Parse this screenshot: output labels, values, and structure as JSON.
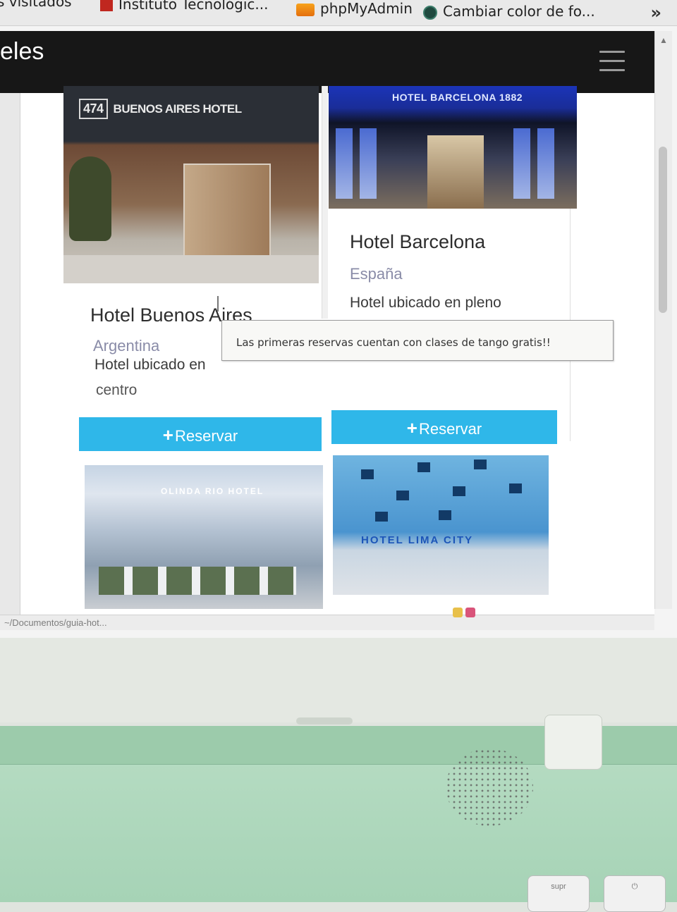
{
  "browser": {
    "bookmarks": [
      {
        "label": "s visitados",
        "icon": ""
      },
      {
        "label": "Instituto Tecnológic...",
        "icon": "institute-icon"
      },
      {
        "label": "phpMyAdmin",
        "icon": "phpmyadmin-icon"
      },
      {
        "label": "Cambiar color de fo...",
        "icon": "globe-icon"
      }
    ],
    "more": "»",
    "status_path": "~/Documentos/guia-hot..."
  },
  "navbar": {
    "brand": "eles",
    "menu_icon": "hamburger-icon"
  },
  "hotels": [
    {
      "name": "Hotel Buenos Aires",
      "country": "Argentina",
      "desc_line1": "Hotel ubicado en",
      "desc_line2": "centro",
      "image_sign": "BUENOS AIRES HOTEL",
      "image_logo": "474",
      "button": "Reservar"
    },
    {
      "name": "Hotel Barcelona",
      "country": "España",
      "desc_line1": "Hotel ubicado en pleno",
      "image_sign": "HOTEL BARCELONA 1882",
      "button": "Reservar"
    },
    {
      "image_sign": "OLINDA RIO HOTEL"
    },
    {
      "image_sign": "HOTEL LIMA CITY"
    }
  ],
  "tooltip": "Las primeras reservas cuentan con clases de tango gratis!!",
  "keyboard": {
    "key_label": "supr"
  },
  "colors": {
    "navbar": "#171717",
    "button": "#2fb7e9",
    "country": "#8a8ca8",
    "laptop_base": "#a6d3b6"
  }
}
